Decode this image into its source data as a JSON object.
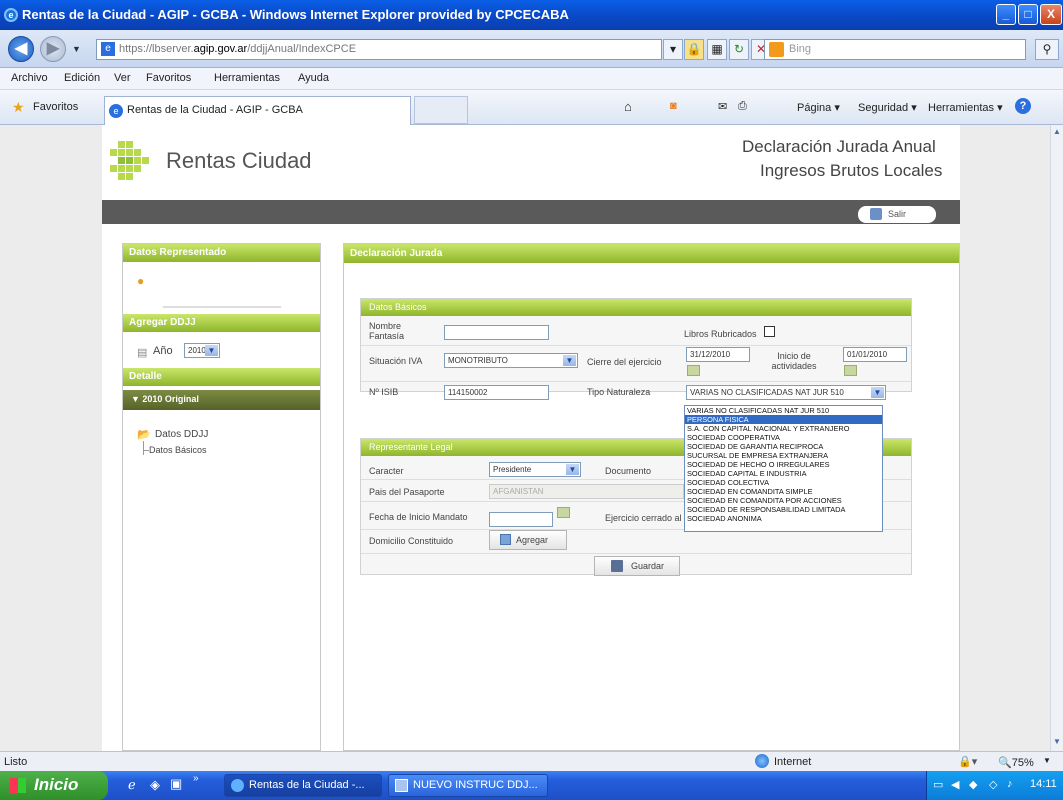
{
  "window": {
    "title": "Rentas de la Ciudad - AGIP - GCBA - Windows Internet Explorer provided by CPCECABA",
    "buttons": [
      "_",
      "□",
      "X"
    ]
  },
  "address": {
    "pre": "https://lbserver.",
    "domain": "agip.gov.ar",
    "post": "/ddjjAnual/IndexCPCE"
  },
  "search": {
    "placeholder": "Bing"
  },
  "menu": [
    "Archivo",
    "Edición",
    "Ver",
    "Favoritos",
    "Herramientas",
    "Ayuda"
  ],
  "favbar": {
    "favorites": "Favoritos",
    "tab": "Rentas de la Ciudad - AGIP - GCBA",
    "tools": [
      "Página",
      "Seguridad",
      "Herramientas"
    ]
  },
  "site": {
    "brand": "Rentas Ciudad",
    "header1": "Declaración Jurada Anual",
    "header2": "Ingresos Brutos Locales",
    "salir": "Salir"
  },
  "left": {
    "representado": "Datos Representado",
    "agregar": "Agregar DDJJ",
    "anio_label": "Año",
    "anio_value": "2010",
    "detalle": "Detalle",
    "version": "▼ 2010 Original",
    "datos_ddjj": "Datos DDJJ",
    "datos_basicos": "Datos Básicos"
  },
  "main": {
    "title": "Declaración Jurada",
    "basicos": {
      "title": "Datos Básicos",
      "nombre_label": "Nombre Fantasía",
      "nombre_value": "",
      "libros_label": "Libros Rubricados",
      "situacion_label": "Situación IVA",
      "situacion_value": "MONOTRIBUTO",
      "cierre_label": "Cierre del ejercicio",
      "cierre_value": "31/12/2010",
      "inicio_label": "Inicio de actividades",
      "inicio_value": "01/01/2010",
      "isib_label": "Nº ISIB",
      "isib_value": "114150002",
      "tipo_label": "Tipo Naturaleza",
      "tipo_value": "VARIAS NO CLASIFICADAS NAT JUR 510"
    },
    "dropdown": [
      "VARIAS NO CLASIFICADAS NAT JUR 510",
      "PERSONA FISICA",
      "S.A. CON CAPITAL NACIONAL Y EXTRANJERO",
      "SOCIEDAD COOPERATIVA",
      "SOCIEDAD DE GARANTIA RECIPROCA",
      "SUCURSAL DE EMPRESA EXTRANJERA",
      "SOCIEDAD DE HECHO O IRREGULARES",
      "SOCIEDAD CAPITAL E INDUSTRIA",
      "SOCIEDAD COLECTIVA",
      "SOCIEDAD EN COMANDITA SIMPLE",
      "SOCIEDAD EN COMANDITA POR ACCIONES",
      "SOCIEDAD DE RESPONSABILIDAD LIMITADA",
      "SOCIEDAD ANONIMA"
    ],
    "rep": {
      "title": "Representante Legal",
      "caracter_label": "Caracter",
      "caracter_value": "Presidente",
      "documento_label": "Documento",
      "pais_label": "Pais del Pasaporte",
      "pais_value": "AFGANISTAN",
      "fecha_label": "Fecha de Inicio Mandato",
      "ejercicio_label": "Ejercicio cerrado al",
      "domicilio_label": "Domicilio Constituido",
      "agregar": "Agregar"
    },
    "guardar": "Guardar"
  },
  "status": {
    "text": "Listo",
    "zone": "Internet",
    "zoom": "75%"
  },
  "taskbar": {
    "start": "Inicio",
    "tasks": [
      "Rentas de la Ciudad -...",
      "NUEVO INSTRUC DDJ..."
    ],
    "time": "14:11"
  }
}
